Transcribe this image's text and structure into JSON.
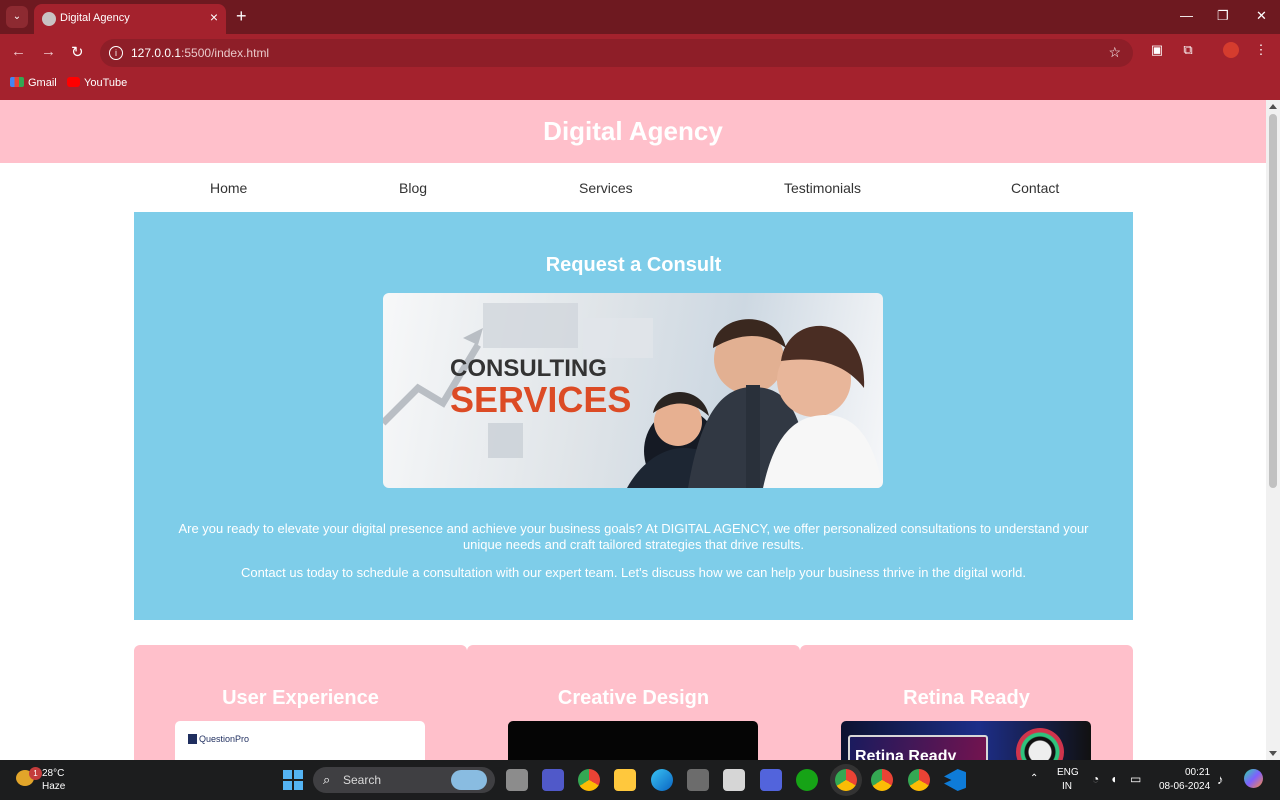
{
  "browser": {
    "tab_title": "Digital Agency",
    "url_host": "127.0.0.1",
    "url_path": ":5500/index.html",
    "bookmarks": [
      "Gmail",
      "YouTube"
    ]
  },
  "site": {
    "title": "Digital Agency",
    "nav": [
      "Home",
      "Blog",
      "Services",
      "Testimonials",
      "Contact"
    ],
    "consult": {
      "title": "Request a Consult",
      "image_text_top": "CONSULTING",
      "image_text_bottom": "SERVICES",
      "paragraph1": "Are you ready to elevate your digital presence and achieve your business goals? At DIGITAL AGENCY, we offer personalized consultations to understand your unique needs and craft tailored strategies that drive results.",
      "paragraph2": "Contact us today to schedule a consultation with our expert team. Let's discuss how we can help your business thrive in the digital world."
    },
    "features": [
      {
        "title": "User Experience",
        "thumb_text": "QuestionPro"
      },
      {
        "title": "Creative Design",
        "thumb_text": ""
      },
      {
        "title": "Retina Ready",
        "thumb_text": "Retina Ready"
      }
    ]
  },
  "taskbar": {
    "temperature": "28°C",
    "condition": "Haze",
    "weather_badge": "1",
    "search_placeholder": "Search",
    "language": "ENG",
    "region": "IN",
    "time": "00:21",
    "date": "08-06-2024"
  },
  "colors": {
    "browser_frame": "#a4222d",
    "header_pink": "#ffc0cb",
    "consult_blue": "#7ecde9"
  }
}
